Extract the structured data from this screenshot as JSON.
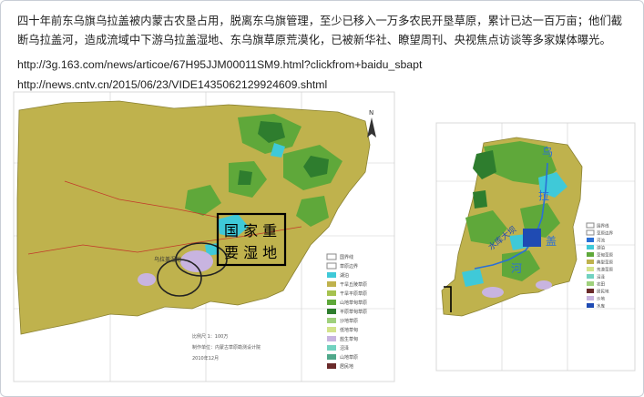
{
  "article": {
    "paragraph": "四十年前东乌旗乌拉盖被内蒙古农垦占用，脱离东乌旗管理，至少已移入一万多农民开垦草原，累计已达一百万亩；他们截断乌拉盖河，造成流域中下游乌拉盖湿地、东乌旗草原荒漠化，已被新华社、瞭望周刊、央视焦点访谈等多家媒体曝光。",
    "url_1": "http://3g.163.com/news/articoe/67H95JJM00011SM9.html?clickfrom+baidu_sbapt",
    "url_2": "http://news.cntv.cn/2015/06/23/VIDE1435062129924609.shtml"
  },
  "left_map": {
    "label_top": "国 家 重",
    "label_bottom": "要 湿 地",
    "place_label": "乌拉盖湿地",
    "north_mark": "N",
    "scale_text": "比例尺 1：100万",
    "credit_text": "制作单位：内蒙古草原勘测设计院",
    "year_text": "2010年12月",
    "legend": [
      "国界线",
      "草原边界",
      "湖泊",
      "干旱丘陵草原",
      "干旱平原草原",
      "山地草甸草原",
      "平原草甸草原",
      "沙地草原",
      "低地草甸",
      "盐生草甸",
      "沼泽",
      "山地草原",
      "居民地"
    ]
  },
  "right_map": {
    "river_chars": [
      "乌",
      "拉",
      "盖",
      "河"
    ],
    "dam_label": "水库大坝",
    "legend": [
      "国界线",
      "草原边界",
      "河流",
      "湖泊",
      "草甸草原",
      "典型草原",
      "荒漠草原",
      "沼泽",
      "农田",
      "居民地",
      "沙地",
      "水库"
    ]
  },
  "colors": {
    "steppe_khaki": "#bfb24d",
    "grassland_green": "#5fa83a",
    "dark_green": "#2e7d2e",
    "water_cyan": "#3fc9d8",
    "lavender": "#c8b4e0",
    "dam_blue": "#1f4bb3",
    "river_blue": "#2a6fd6"
  }
}
